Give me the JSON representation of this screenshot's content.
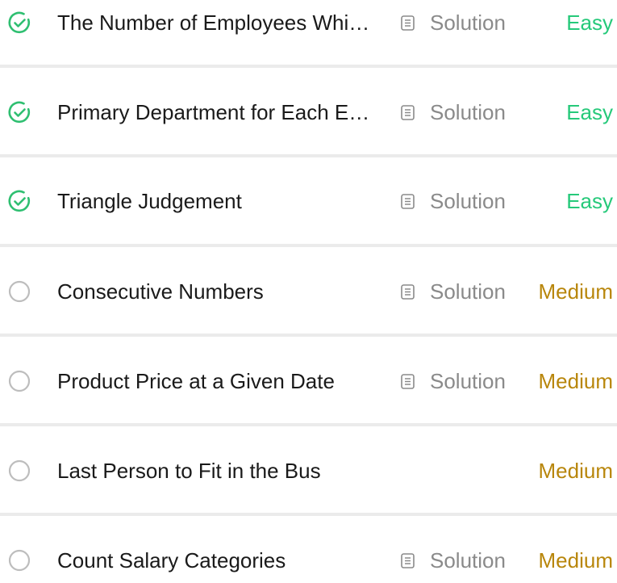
{
  "colors": {
    "solved_check": "#2fbf71",
    "unsolved_circle": "#bdbdbd",
    "easy": "#26c97a",
    "medium": "#b8860b",
    "solution_text": "#8a8a8a",
    "divider": "#ebebeb"
  },
  "problems": [
    {
      "title": "The Number of Employees Whi…",
      "status": "solved",
      "status_icon": "check-circle-icon",
      "solution_icon": "document-icon",
      "solution_label": "Solution",
      "difficulty": "Easy",
      "truncated": true
    },
    {
      "title": "Primary Department for Each E…",
      "status": "solved",
      "status_icon": "check-circle-icon",
      "solution_icon": "document-icon",
      "solution_label": "Solution",
      "difficulty": "Easy",
      "truncated": true
    },
    {
      "title": "Triangle Judgement",
      "status": "solved",
      "status_icon": "check-circle-icon",
      "solution_icon": "document-icon",
      "solution_label": "Solution",
      "difficulty": "Easy"
    },
    {
      "title": "Consecutive Numbers",
      "status": "unsolved",
      "status_icon": "empty-circle-icon",
      "solution_icon": "document-icon",
      "solution_label": "Solution",
      "difficulty": "Medium"
    },
    {
      "title": "Product Price at a Given Date",
      "status": "unsolved",
      "status_icon": "empty-circle-icon",
      "solution_icon": "document-icon",
      "solution_label": "Solution",
      "difficulty": "Medium"
    },
    {
      "title": "Last Person to Fit in the Bus",
      "status": "unsolved",
      "status_icon": "empty-circle-icon",
      "solution_label": "",
      "difficulty": "Medium"
    },
    {
      "title": "Count Salary Categories",
      "status": "unsolved",
      "status_icon": "empty-circle-icon",
      "solution_icon": "document-icon",
      "solution_label": "Solution",
      "difficulty": "Medium"
    }
  ]
}
